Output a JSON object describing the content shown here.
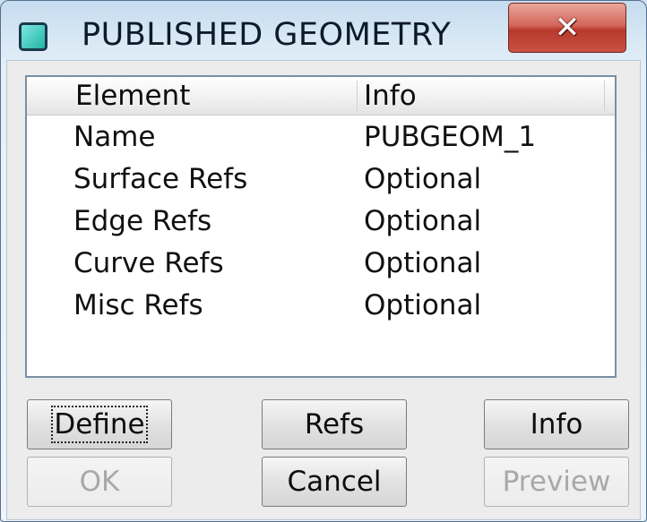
{
  "window": {
    "title": "PUBLISHED GEOMETRY",
    "close_glyph": "✕"
  },
  "table": {
    "columns": [
      "Element",
      "Info"
    ],
    "rows": [
      {
        "element": "Name",
        "info": "PUBGEOM_1"
      },
      {
        "element": "Surface Refs",
        "info": "Optional"
      },
      {
        "element": "Edge Refs",
        "info": "Optional"
      },
      {
        "element": "Curve Refs",
        "info": "Optional"
      },
      {
        "element": "Misc Refs",
        "info": "Optional"
      }
    ]
  },
  "buttons": {
    "define": "Define",
    "refs": "Refs",
    "info": "Info",
    "ok": "OK",
    "cancel": "Cancel",
    "preview": "Preview"
  },
  "icons": {
    "app": "dialog-geometry-icon",
    "close": "close-icon"
  }
}
